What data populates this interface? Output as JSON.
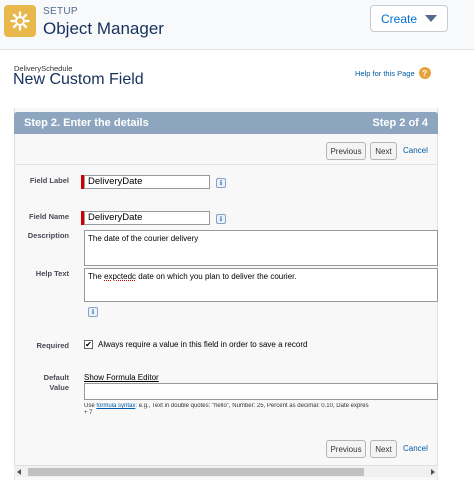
{
  "header": {
    "section": "SETUP",
    "title": "Object Manager",
    "create_label": "Create"
  },
  "page": {
    "object_name": "DeliverySchedule",
    "title": "New Custom Field",
    "help_link": "Help for this Page"
  },
  "step": {
    "title": "Step 2. Enter the details",
    "count": "Step 2 of 4"
  },
  "nav": {
    "previous": "Previous",
    "next": "Next",
    "cancel": "Cancel"
  },
  "form": {
    "field_label": {
      "label": "Field Label",
      "value": "DeliveryDate",
      "info": "i"
    },
    "field_name": {
      "label": "Field Name",
      "value": "DeliveryDate",
      "info": "i"
    },
    "description": {
      "label": "Description",
      "value": "The date  of the courier delivery"
    },
    "help_text": {
      "label": "Help Text",
      "value_before": "The ",
      "value_misspelled": "expctedc",
      "value_after": " date on which you plan to deliver the courier.",
      "info": "i"
    },
    "required": {
      "label": "Required",
      "checked": true,
      "check_mark": "✔",
      "text": "Always require a value in this field in order to save a record"
    },
    "default_value": {
      "label_line1": "Default",
      "label_line2": "Value",
      "formula_link": "Show Formula Editor",
      "hint_prefix": "Use ",
      "hint_link": "formula syntax",
      "hint_rest": ": e.g., Text in double quotes: \"hello\", Number: 25, Percent as decimal: 0.10, Date expres",
      "hint_line2": "+ 7"
    }
  },
  "colors": {
    "step_bar": "#8da5bf",
    "setup_icon": "#e8b84c",
    "required_marker": "#cc0000",
    "link": "#015ba7"
  },
  "icons": {
    "setup": "gear-icon",
    "create_caret": "caret-down-icon",
    "help": "help-icon",
    "info": "info-icon"
  }
}
